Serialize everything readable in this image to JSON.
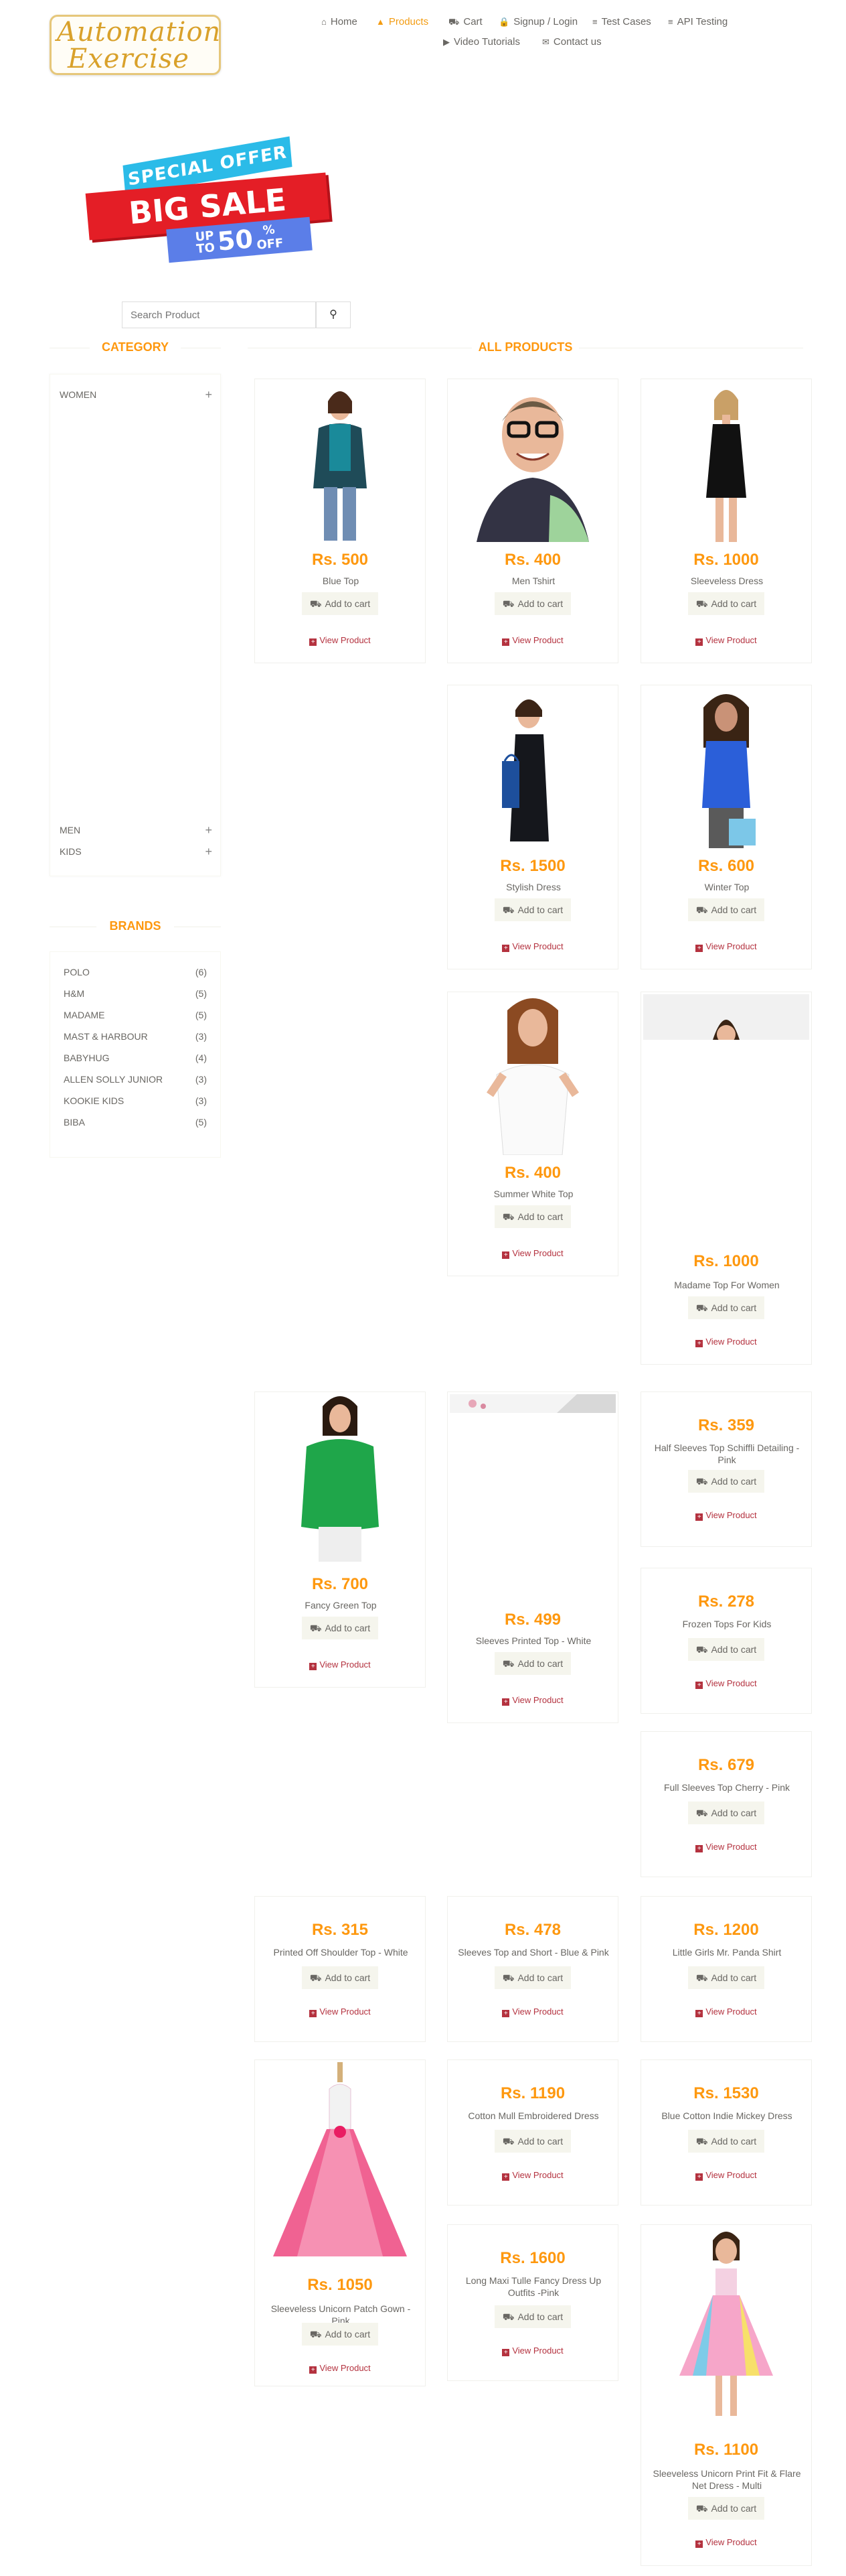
{
  "logo": {
    "line1": "Automation",
    "line2": "Exercise"
  },
  "nav": [
    {
      "label": "Home",
      "icon": "home-icon",
      "glyph": "⌂"
    },
    {
      "label": "Products",
      "icon": "products-icon",
      "glyph": "▲"
    },
    {
      "label": "Cart",
      "icon": "cart-icon",
      "glyph": "⛟"
    },
    {
      "label": "Signup / Login",
      "icon": "lock-icon",
      "glyph": "🔒"
    },
    {
      "label": "Test Cases",
      "icon": "list-icon",
      "glyph": "≡"
    },
    {
      "label": "API Testing",
      "icon": "list-icon",
      "glyph": "≡"
    },
    {
      "label": "Video Tutorials",
      "icon": "youtube-icon",
      "glyph": "▶"
    },
    {
      "label": "Contact us",
      "icon": "envelope-icon",
      "glyph": "✉"
    }
  ],
  "banner": {
    "special": "SPECIAL OFFER",
    "big": "BIG SALE",
    "upto": "UP",
    "to": "TO",
    "pct": "50",
    "pct_sign": "%",
    "off": "OFF"
  },
  "search": {
    "placeholder": "Search Product"
  },
  "category": {
    "title": "CATEGORY",
    "items": [
      "WOMEN",
      "MEN",
      "KIDS"
    ]
  },
  "brands": {
    "title": "BRANDS",
    "items": [
      {
        "name": "POLO",
        "count": "(6)"
      },
      {
        "name": "H&M",
        "count": "(5)"
      },
      {
        "name": "MADAME",
        "count": "(5)"
      },
      {
        "name": "MAST & HARBOUR",
        "count": "(3)"
      },
      {
        "name": "BABYHUG",
        "count": "(4)"
      },
      {
        "name": "ALLEN SOLLY JUNIOR",
        "count": "(3)"
      },
      {
        "name": "KOOKIE KIDS",
        "count": "(3)"
      },
      {
        "name": "BIBA",
        "count": "(5)"
      }
    ]
  },
  "products_title": "ALL PRODUCTS",
  "add_to_cart": "Add to cart",
  "view_product": "View Product",
  "products": [
    {
      "price": "Rs. 500",
      "name": "Blue Top"
    },
    {
      "price": "Rs. 400",
      "name": "Men Tshirt"
    },
    {
      "price": "Rs. 1000",
      "name": "Sleeveless Dress"
    },
    {
      "price": "Rs. 1500",
      "name": "Stylish Dress"
    },
    {
      "price": "Rs. 600",
      "name": "Winter Top"
    },
    {
      "price": "Rs. 400",
      "name": "Summer White Top"
    },
    {
      "price": "Rs. 1000",
      "name": "Madame Top For Women"
    },
    {
      "price": "Rs. 700",
      "name": "Fancy Green Top"
    },
    {
      "price": "Rs. 499",
      "name": "Sleeves Printed Top - White"
    },
    {
      "price": "Rs. 359",
      "name": "Half Sleeves Top Schiffli Detailing - Pink"
    },
    {
      "price": "Rs. 278",
      "name": "Frozen Tops For Kids"
    },
    {
      "price": "Rs. 679",
      "name": "Full Sleeves Top Cherry - Pink"
    },
    {
      "price": "Rs. 315",
      "name": "Printed Off Shoulder Top - White"
    },
    {
      "price": "Rs. 478",
      "name": "Sleeves Top and Short - Blue & Pink"
    },
    {
      "price": "Rs. 1200",
      "name": "Little Girls Mr. Panda Shirt"
    },
    {
      "price": "Rs. 1050",
      "name": "Sleeveless Unicorn Patch Gown - Pink"
    },
    {
      "price": "Rs. 1190",
      "name": "Cotton Mull Embroidered Dress"
    },
    {
      "price": "Rs. 1530",
      "name": "Blue Cotton Indie Mickey Dress"
    },
    {
      "price": "Rs. 1600",
      "name": "Long Maxi Tulle Fancy Dress Up Outfits -Pink"
    },
    {
      "price": "Rs. 1100",
      "name": "Sleeveless Unicorn Print Fit & Flare Net Dress - Multi"
    }
  ],
  "colors": {
    "accent": "#fe980f",
    "link": "#b4323f",
    "nav_active": "#f39c12"
  }
}
